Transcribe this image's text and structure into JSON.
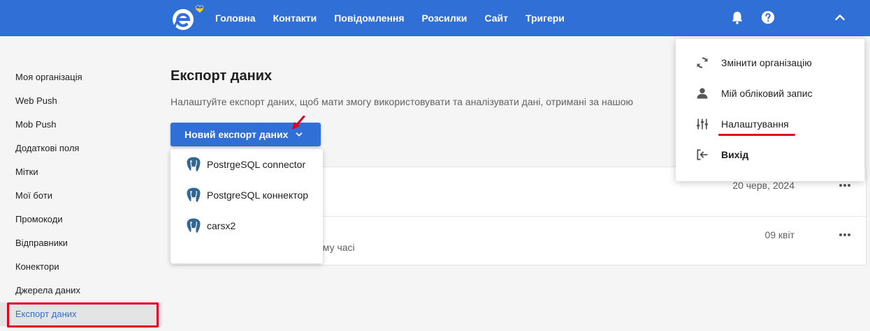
{
  "header": {
    "logo_icon": "brand-logo-icon",
    "nav": [
      {
        "label": "Головна"
      },
      {
        "label": "Контакти"
      },
      {
        "label": "Повідомлення"
      },
      {
        "label": "Розсилки"
      },
      {
        "label": "Сайт"
      },
      {
        "label": "Тригери"
      }
    ],
    "icons": [
      "bell-icon",
      "help-icon",
      "chevron-up-icon"
    ]
  },
  "sidebar": {
    "items": [
      {
        "label": "Моя організація"
      },
      {
        "label": "Web Push"
      },
      {
        "label": "Mob Push"
      },
      {
        "label": "Додаткові поля"
      },
      {
        "label": "Мітки"
      },
      {
        "label": "Мої боти"
      },
      {
        "label": "Промокоди"
      },
      {
        "label": "Відправники"
      },
      {
        "label": "Конектори"
      },
      {
        "label": "Джерела даних"
      },
      {
        "label": "Експорт даних"
      }
    ],
    "active_index": 10
  },
  "main": {
    "title": "Експорт даних",
    "subtitle": "Налаштуйте експорт даних, щоб мати змогу використовувати та аналізувати дані, отримані за нашою",
    "new_button_label": "Новий експорт даних",
    "dropdown": [
      {
        "label": "PostrgeSQL connector",
        "icon": "postgresql-icon"
      },
      {
        "label": "PostgreSQL коннектор",
        "icon": "postgresql-icon"
      },
      {
        "label": "carsx2",
        "icon": "postgresql-icon"
      }
    ],
    "rows": [
      {
        "date": "20 черв, 2024",
        "note": ""
      },
      {
        "date": "09 квіт",
        "note": "ому часі"
      }
    ]
  },
  "user_menu": {
    "items": [
      {
        "label": "Змінити організацію",
        "icon": "sync-icon"
      },
      {
        "label": "Мій обліковий запис",
        "icon": "person-icon"
      },
      {
        "label": "Налаштування",
        "icon": "sliders-icon"
      },
      {
        "label": "Вихід",
        "icon": "logout-icon"
      }
    ]
  },
  "colors": {
    "primary": "#2f6fd6",
    "highlight": "#e0001b"
  }
}
